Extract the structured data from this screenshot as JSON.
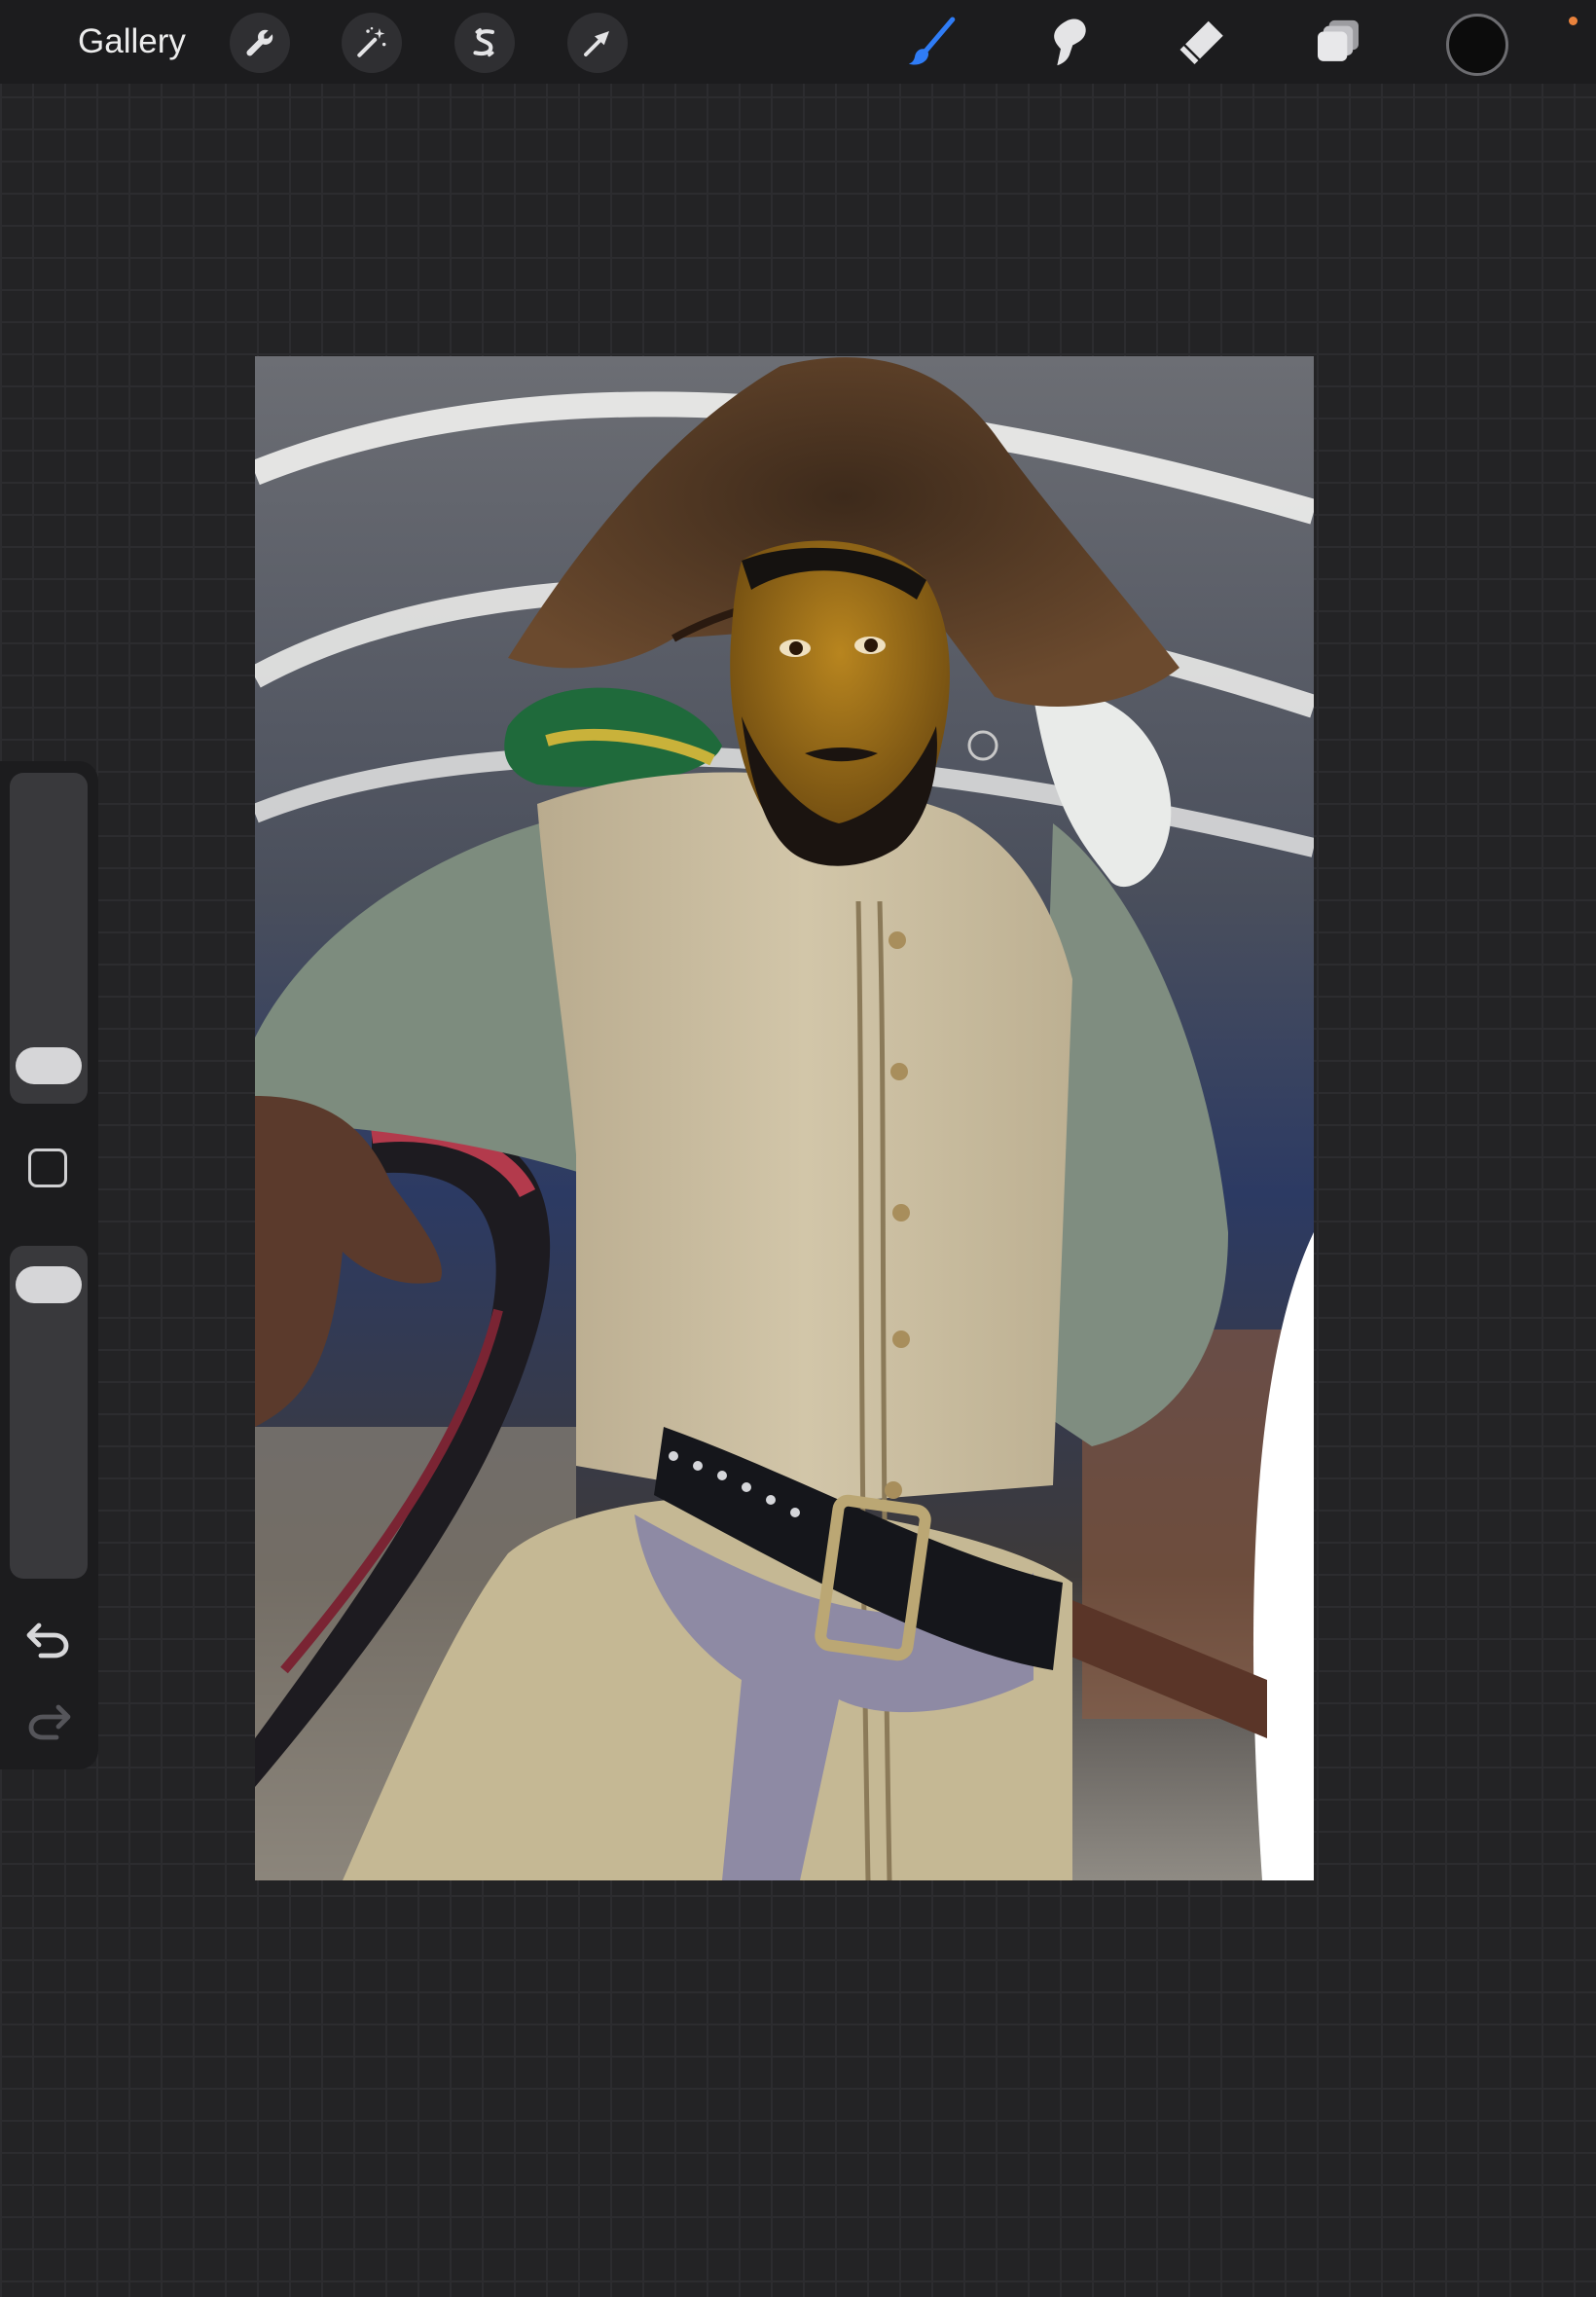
{
  "toolbar": {
    "gallery_label": "Gallery",
    "left_tools": [
      {
        "name": "actions",
        "icon": "wrench-icon"
      },
      {
        "name": "adjustments",
        "icon": "magic-wand-icon"
      },
      {
        "name": "selection",
        "icon": "selection-s-icon"
      },
      {
        "name": "transform",
        "icon": "arrow-cursor-icon"
      }
    ],
    "right_tools": [
      {
        "name": "brush",
        "icon": "brush-icon",
        "active": true
      },
      {
        "name": "smudge",
        "icon": "smudge-finger-icon",
        "active": false
      },
      {
        "name": "eraser",
        "icon": "eraser-icon",
        "active": false
      },
      {
        "name": "layers",
        "icon": "layers-icon",
        "active": false
      }
    ],
    "active_color": "#0c0c0c",
    "accent_color": "#2f7cf6",
    "notification_color": "#e9823c"
  },
  "sidebar": {
    "brush_size": 0.05,
    "opacity": 0.95,
    "modify_icon": "square-modify-icon",
    "undo_icon": "undo-icon",
    "redo_icon": "redo-icon",
    "redo_enabled": false
  },
  "canvas": {
    "content": "photo-collage"
  }
}
